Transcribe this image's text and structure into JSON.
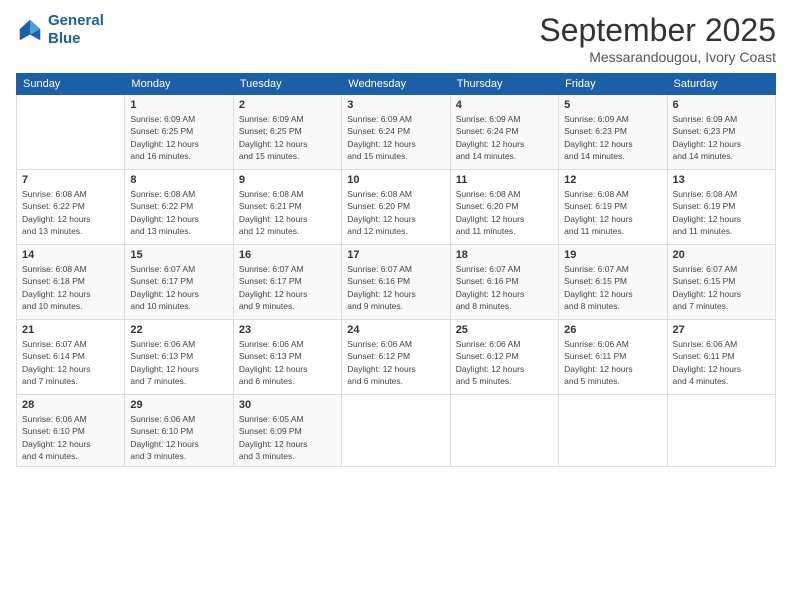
{
  "logo": {
    "line1": "General",
    "line2": "Blue"
  },
  "header": {
    "month": "September 2025",
    "location": "Messarandougou, Ivory Coast"
  },
  "weekdays": [
    "Sunday",
    "Monday",
    "Tuesday",
    "Wednesday",
    "Thursday",
    "Friday",
    "Saturday"
  ],
  "weeks": [
    [
      {
        "day": "",
        "info": ""
      },
      {
        "day": "1",
        "info": "Sunrise: 6:09 AM\nSunset: 6:25 PM\nDaylight: 12 hours\nand 16 minutes."
      },
      {
        "day": "2",
        "info": "Sunrise: 6:09 AM\nSunset: 6:25 PM\nDaylight: 12 hours\nand 15 minutes."
      },
      {
        "day": "3",
        "info": "Sunrise: 6:09 AM\nSunset: 6:24 PM\nDaylight: 12 hours\nand 15 minutes."
      },
      {
        "day": "4",
        "info": "Sunrise: 6:09 AM\nSunset: 6:24 PM\nDaylight: 12 hours\nand 14 minutes."
      },
      {
        "day": "5",
        "info": "Sunrise: 6:09 AM\nSunset: 6:23 PM\nDaylight: 12 hours\nand 14 minutes."
      },
      {
        "day": "6",
        "info": "Sunrise: 6:09 AM\nSunset: 6:23 PM\nDaylight: 12 hours\nand 14 minutes."
      }
    ],
    [
      {
        "day": "7",
        "info": "Sunrise: 6:08 AM\nSunset: 6:22 PM\nDaylight: 12 hours\nand 13 minutes."
      },
      {
        "day": "8",
        "info": "Sunrise: 6:08 AM\nSunset: 6:22 PM\nDaylight: 12 hours\nand 13 minutes."
      },
      {
        "day": "9",
        "info": "Sunrise: 6:08 AM\nSunset: 6:21 PM\nDaylight: 12 hours\nand 12 minutes."
      },
      {
        "day": "10",
        "info": "Sunrise: 6:08 AM\nSunset: 6:20 PM\nDaylight: 12 hours\nand 12 minutes."
      },
      {
        "day": "11",
        "info": "Sunrise: 6:08 AM\nSunset: 6:20 PM\nDaylight: 12 hours\nand 11 minutes."
      },
      {
        "day": "12",
        "info": "Sunrise: 6:08 AM\nSunset: 6:19 PM\nDaylight: 12 hours\nand 11 minutes."
      },
      {
        "day": "13",
        "info": "Sunrise: 6:08 AM\nSunset: 6:19 PM\nDaylight: 12 hours\nand 11 minutes."
      }
    ],
    [
      {
        "day": "14",
        "info": "Sunrise: 6:08 AM\nSunset: 6:18 PM\nDaylight: 12 hours\nand 10 minutes."
      },
      {
        "day": "15",
        "info": "Sunrise: 6:07 AM\nSunset: 6:17 PM\nDaylight: 12 hours\nand 10 minutes."
      },
      {
        "day": "16",
        "info": "Sunrise: 6:07 AM\nSunset: 6:17 PM\nDaylight: 12 hours\nand 9 minutes."
      },
      {
        "day": "17",
        "info": "Sunrise: 6:07 AM\nSunset: 6:16 PM\nDaylight: 12 hours\nand 9 minutes."
      },
      {
        "day": "18",
        "info": "Sunrise: 6:07 AM\nSunset: 6:16 PM\nDaylight: 12 hours\nand 8 minutes."
      },
      {
        "day": "19",
        "info": "Sunrise: 6:07 AM\nSunset: 6:15 PM\nDaylight: 12 hours\nand 8 minutes."
      },
      {
        "day": "20",
        "info": "Sunrise: 6:07 AM\nSunset: 6:15 PM\nDaylight: 12 hours\nand 7 minutes."
      }
    ],
    [
      {
        "day": "21",
        "info": "Sunrise: 6:07 AM\nSunset: 6:14 PM\nDaylight: 12 hours\nand 7 minutes."
      },
      {
        "day": "22",
        "info": "Sunrise: 6:06 AM\nSunset: 6:13 PM\nDaylight: 12 hours\nand 7 minutes."
      },
      {
        "day": "23",
        "info": "Sunrise: 6:06 AM\nSunset: 6:13 PM\nDaylight: 12 hours\nand 6 minutes."
      },
      {
        "day": "24",
        "info": "Sunrise: 6:06 AM\nSunset: 6:12 PM\nDaylight: 12 hours\nand 6 minutes."
      },
      {
        "day": "25",
        "info": "Sunrise: 6:06 AM\nSunset: 6:12 PM\nDaylight: 12 hours\nand 5 minutes."
      },
      {
        "day": "26",
        "info": "Sunrise: 6:06 AM\nSunset: 6:11 PM\nDaylight: 12 hours\nand 5 minutes."
      },
      {
        "day": "27",
        "info": "Sunrise: 6:06 AM\nSunset: 6:11 PM\nDaylight: 12 hours\nand 4 minutes."
      }
    ],
    [
      {
        "day": "28",
        "info": "Sunrise: 6:06 AM\nSunset: 6:10 PM\nDaylight: 12 hours\nand 4 minutes."
      },
      {
        "day": "29",
        "info": "Sunrise: 6:06 AM\nSunset: 6:10 PM\nDaylight: 12 hours\nand 3 minutes."
      },
      {
        "day": "30",
        "info": "Sunrise: 6:05 AM\nSunset: 6:09 PM\nDaylight: 12 hours\nand 3 minutes."
      },
      {
        "day": "",
        "info": ""
      },
      {
        "day": "",
        "info": ""
      },
      {
        "day": "",
        "info": ""
      },
      {
        "day": "",
        "info": ""
      }
    ]
  ]
}
